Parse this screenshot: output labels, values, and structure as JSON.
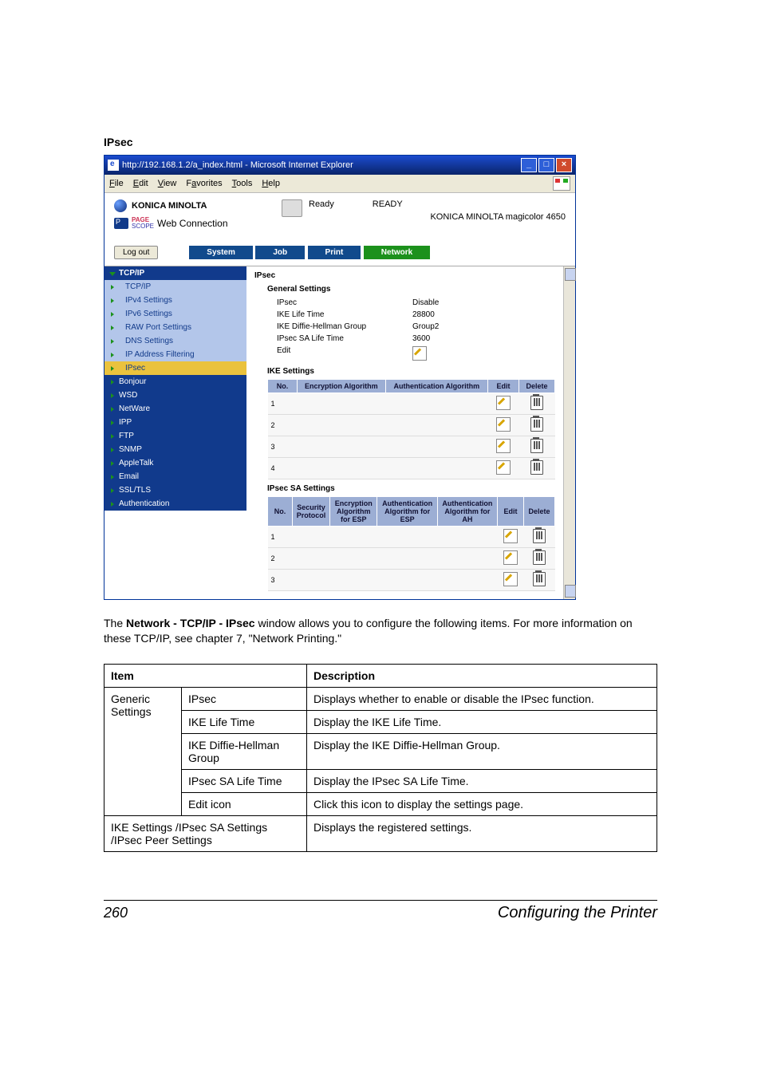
{
  "section_label": "IPsec",
  "screenshot": {
    "window_title": "http://192.168.1.2/a_index.html - Microsoft Internet Explorer",
    "menu": [
      "File",
      "Edit",
      "View",
      "Favorites",
      "Tools",
      "Help"
    ],
    "brand": "KONICA MINOLTA",
    "pagescope_page": "PAGE",
    "pagescope_scope": "SCOPE",
    "web_connection": "Web Connection",
    "status_ready_label": "Ready",
    "status_ready_big": "READY",
    "model": "KONICA MINOLTA magicolor 4650",
    "logout": "Log out",
    "tabs": [
      "System",
      "Job",
      "Print",
      "Network"
    ],
    "nav": {
      "top": "TCP/IP",
      "sub": [
        "TCP/IP",
        "IPv4 Settings",
        "IPv6 Settings",
        "RAW Port Settings",
        "DNS Settings",
        "IP Address Filtering",
        "IPsec"
      ],
      "rest": [
        "Bonjour",
        "WSD",
        "NetWare",
        "IPP",
        "FTP",
        "SNMP",
        "AppleTalk",
        "Email",
        "SSL/TLS",
        "Authentication"
      ]
    },
    "content": {
      "title": "IPsec",
      "general_settings": "General Settings",
      "rows": [
        {
          "label": "IPsec",
          "value": "Disable"
        },
        {
          "label": "IKE Life Time",
          "value": "28800"
        },
        {
          "label": "IKE Diffie-Hellman Group",
          "value": "Group2"
        },
        {
          "label": "IPsec SA Life Time",
          "value": "3600"
        },
        {
          "label": "Edit",
          "value": ""
        }
      ],
      "ike_settings": "IKE Settings",
      "ike_headers": [
        "No.",
        "Encryption Algorithm",
        "Authentication Algorithm",
        "Edit",
        "Delete"
      ],
      "ike_rows": [
        "1",
        "2",
        "3",
        "4"
      ],
      "sa_settings": "IPsec SA Settings",
      "sa_headers": [
        "No.",
        "Security Protocol",
        "Encryption Algorithm for ESP",
        "Authentication Algorithm for ESP",
        "Authentication Algorithm for AH",
        "Edit",
        "Delete"
      ],
      "sa_rows": [
        "1",
        "2",
        "3"
      ]
    }
  },
  "paragraph": {
    "p1a": "The ",
    "p1b": "Network - TCP/IP - IPsec",
    "p1c": " window allows you to configure the following items. For more information on these TCP/IP, see chapter 7,  \"Network Printing.\""
  },
  "table": {
    "h1": "Item",
    "h2": "Description",
    "r1c1a": "Generic Settings",
    "r1c1b": "IPsec",
    "r1c2": "Displays whether to enable or disable the IPsec function.",
    "r2c1": "IKE Life Time",
    "r2c2": "Display the IKE Life Time.",
    "r3c1": "IKE Diffie-Hellman Group",
    "r3c2": "Display the IKE Diffie-Hellman Group.",
    "r4c1": "IPsec SA Life Time",
    "r4c2": "Display the IPsec SA Life Time.",
    "r5c1": "Edit icon",
    "r5c2": "Click this icon to display the settings page.",
    "r6c1": "IKE Settings /IPsec SA Settings /IPsec Peer Settings",
    "r6c2": "Displays the registered settings."
  },
  "footer": {
    "page": "260",
    "title": "Configuring the Printer"
  }
}
